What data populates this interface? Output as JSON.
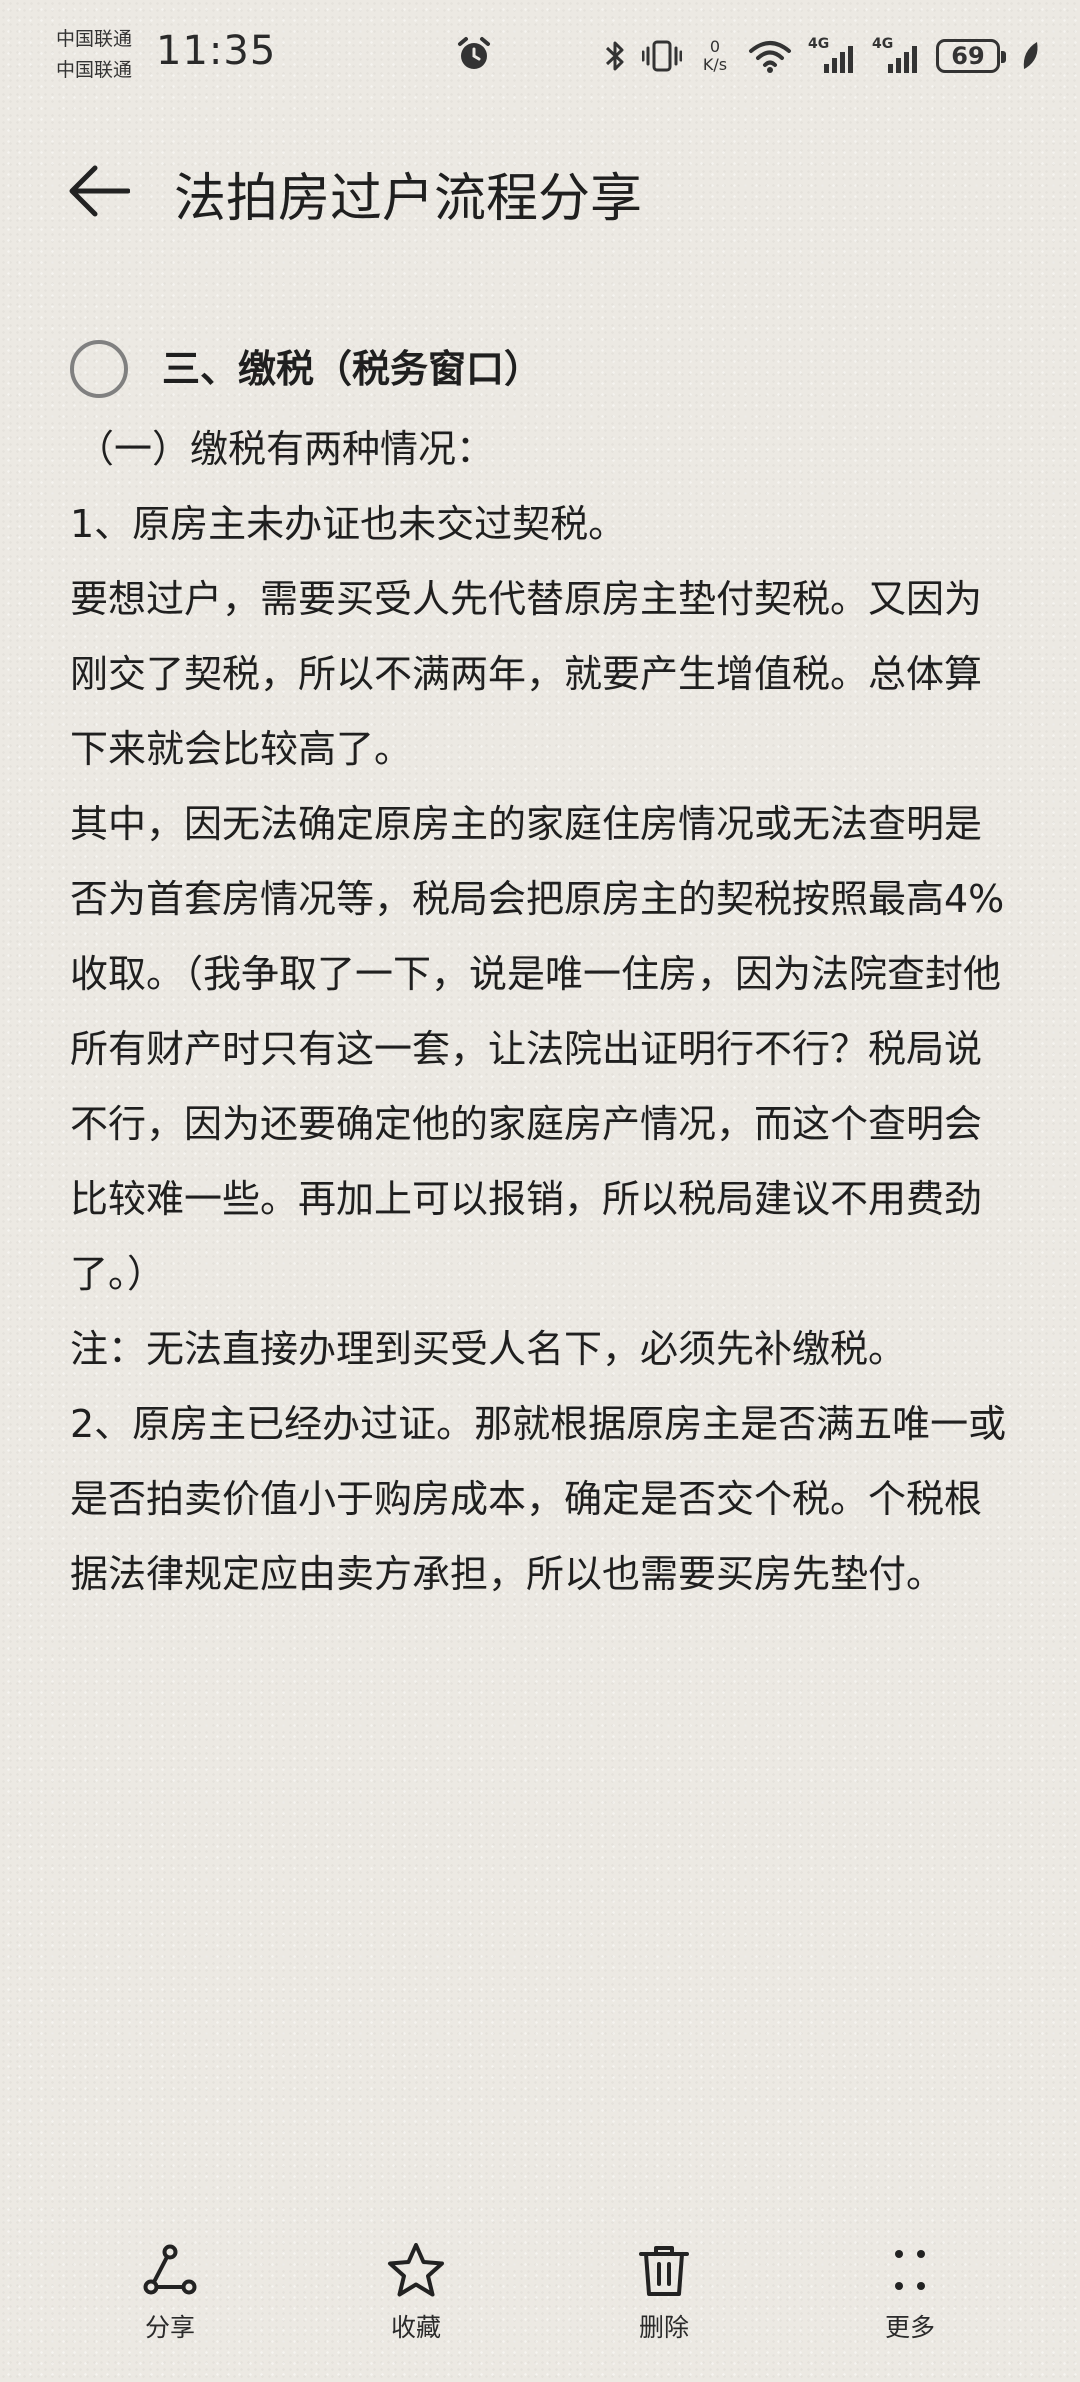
{
  "status_bar": {
    "carrier_1": "中国联通",
    "carrier_2": "中国联通",
    "time": "11:35",
    "net_speed_value": "0",
    "net_speed_unit": "K/s",
    "signal_1_tag": "4G",
    "signal_2_tag": "4G",
    "battery": "69",
    "icons": [
      "alarm-icon",
      "bluetooth-icon",
      "vibrate-icon",
      "wifi-icon",
      "signal-icon",
      "battery-icon",
      "leaf-icon"
    ]
  },
  "header": {
    "title": "法拍房过户流程分享"
  },
  "content": {
    "todo": {
      "label": "三、缴税（税务窗口）",
      "checked": false
    },
    "paragraphs": [
      "（一）缴税有两种情况：",
      "1、原房主未办证也未交过契税。",
      "要想过户，需要买受人先代替原房主垫付契税。又因为刚交了契税，所以不满两年，就要产生增值税。总体算下来就会比较高了。",
      "其中，因无法确定原房主的家庭住房情况或无法查明是否为首套房情况等，税局会把原房主的契税按照最高4%收取。（我争取了一下，说是唯一住房，因为法院查封他所有财产时只有这一套，让法院出证明行不行？税局说不行，因为还要确定他的家庭房产情况，而这个查明会比较难一些。再加上可以报销，所以税局建议不用费劲了。）",
      "注：无法直接办理到买受人名下，必须先补缴税。",
      "2、原房主已经办过证。那就根据原房主是否满五唯一或是否拍卖价值小于购房成本，确定是否交个税。个税根据法律规定应由卖方承担，所以也需要买房先垫付。"
    ]
  },
  "toolbar": {
    "share_label": "分享",
    "favorite_label": "收藏",
    "delete_label": "删除",
    "more_label": "更多"
  }
}
